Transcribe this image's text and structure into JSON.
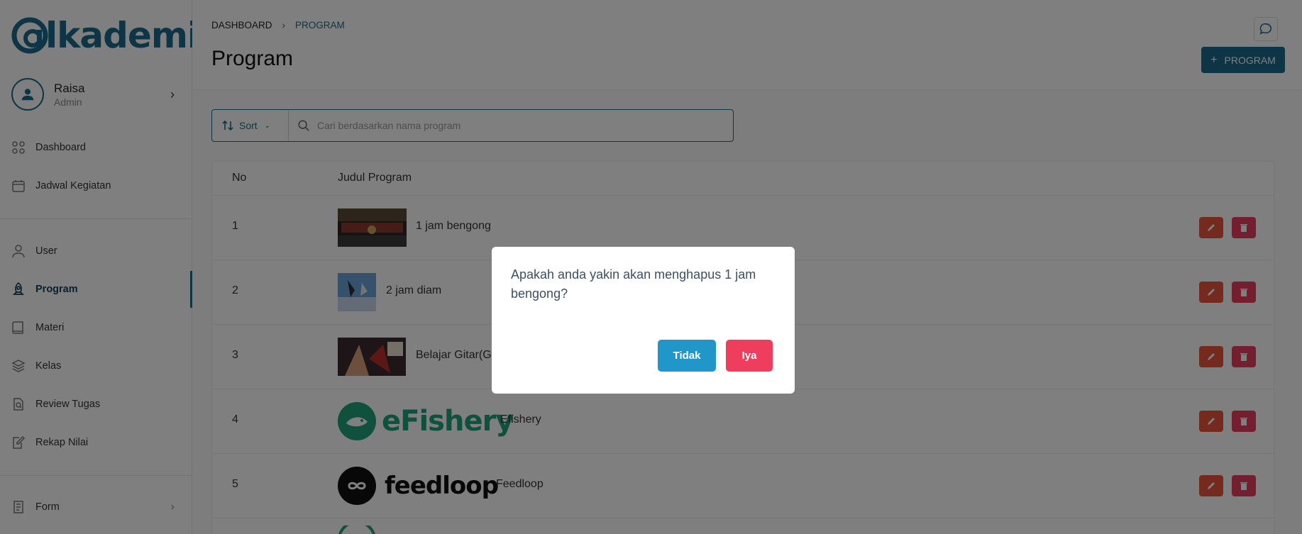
{
  "app": {
    "logo_text": "lkademi"
  },
  "profile": {
    "name": "Raisa",
    "role": "Admin"
  },
  "sidebar": {
    "top_items": [
      {
        "label": "Dashboard",
        "icon": "dashboard-icon"
      },
      {
        "label": "Jadwal Kegiatan",
        "icon": "calendar-icon"
      }
    ],
    "items": [
      {
        "label": "User",
        "icon": "user-icon"
      },
      {
        "label": "Program",
        "icon": "rocket-icon",
        "active": true
      },
      {
        "label": "Materi",
        "icon": "book-icon"
      },
      {
        "label": "Kelas",
        "icon": "layers-icon"
      },
      {
        "label": "Review Tugas",
        "icon": "review-icon"
      },
      {
        "label": "Rekap Nilai",
        "icon": "edit-note-icon"
      }
    ],
    "bottom_items": [
      {
        "label": "Form",
        "icon": "form-icon"
      }
    ]
  },
  "breadcrumb": {
    "home": "DASHBOARD",
    "current": "PROGRAM"
  },
  "page": {
    "title": "Program",
    "add_button": "PROGRAM"
  },
  "filter": {
    "sort_label": "Sort",
    "search_placeholder": "Cari berdasarkan nama program",
    "search_value": ""
  },
  "table": {
    "headers": {
      "no": "No",
      "title": "Judul Program"
    },
    "rows": [
      {
        "no": "1",
        "title": "1 jam bengong"
      },
      {
        "no": "2",
        "title": "2 jam diam"
      },
      {
        "no": "3",
        "title": "Belajar Gitar(G"
      },
      {
        "no": "4",
        "title": "Efishery",
        "logo_text": "eFishery"
      },
      {
        "no": "5",
        "title": "Feedloop",
        "logo_text": "feedloop"
      }
    ]
  },
  "modal": {
    "message": "Apakah anda yakin akan menghapus 1 jam bengong?",
    "cancel_label": "Tidak",
    "confirm_label": "Iya"
  },
  "colors": {
    "primary": "#1a6b8c",
    "edit": "#e8553a",
    "delete": "#e83e5e",
    "modal_no": "#2196c9",
    "modal_yes": "#f03c5d"
  }
}
